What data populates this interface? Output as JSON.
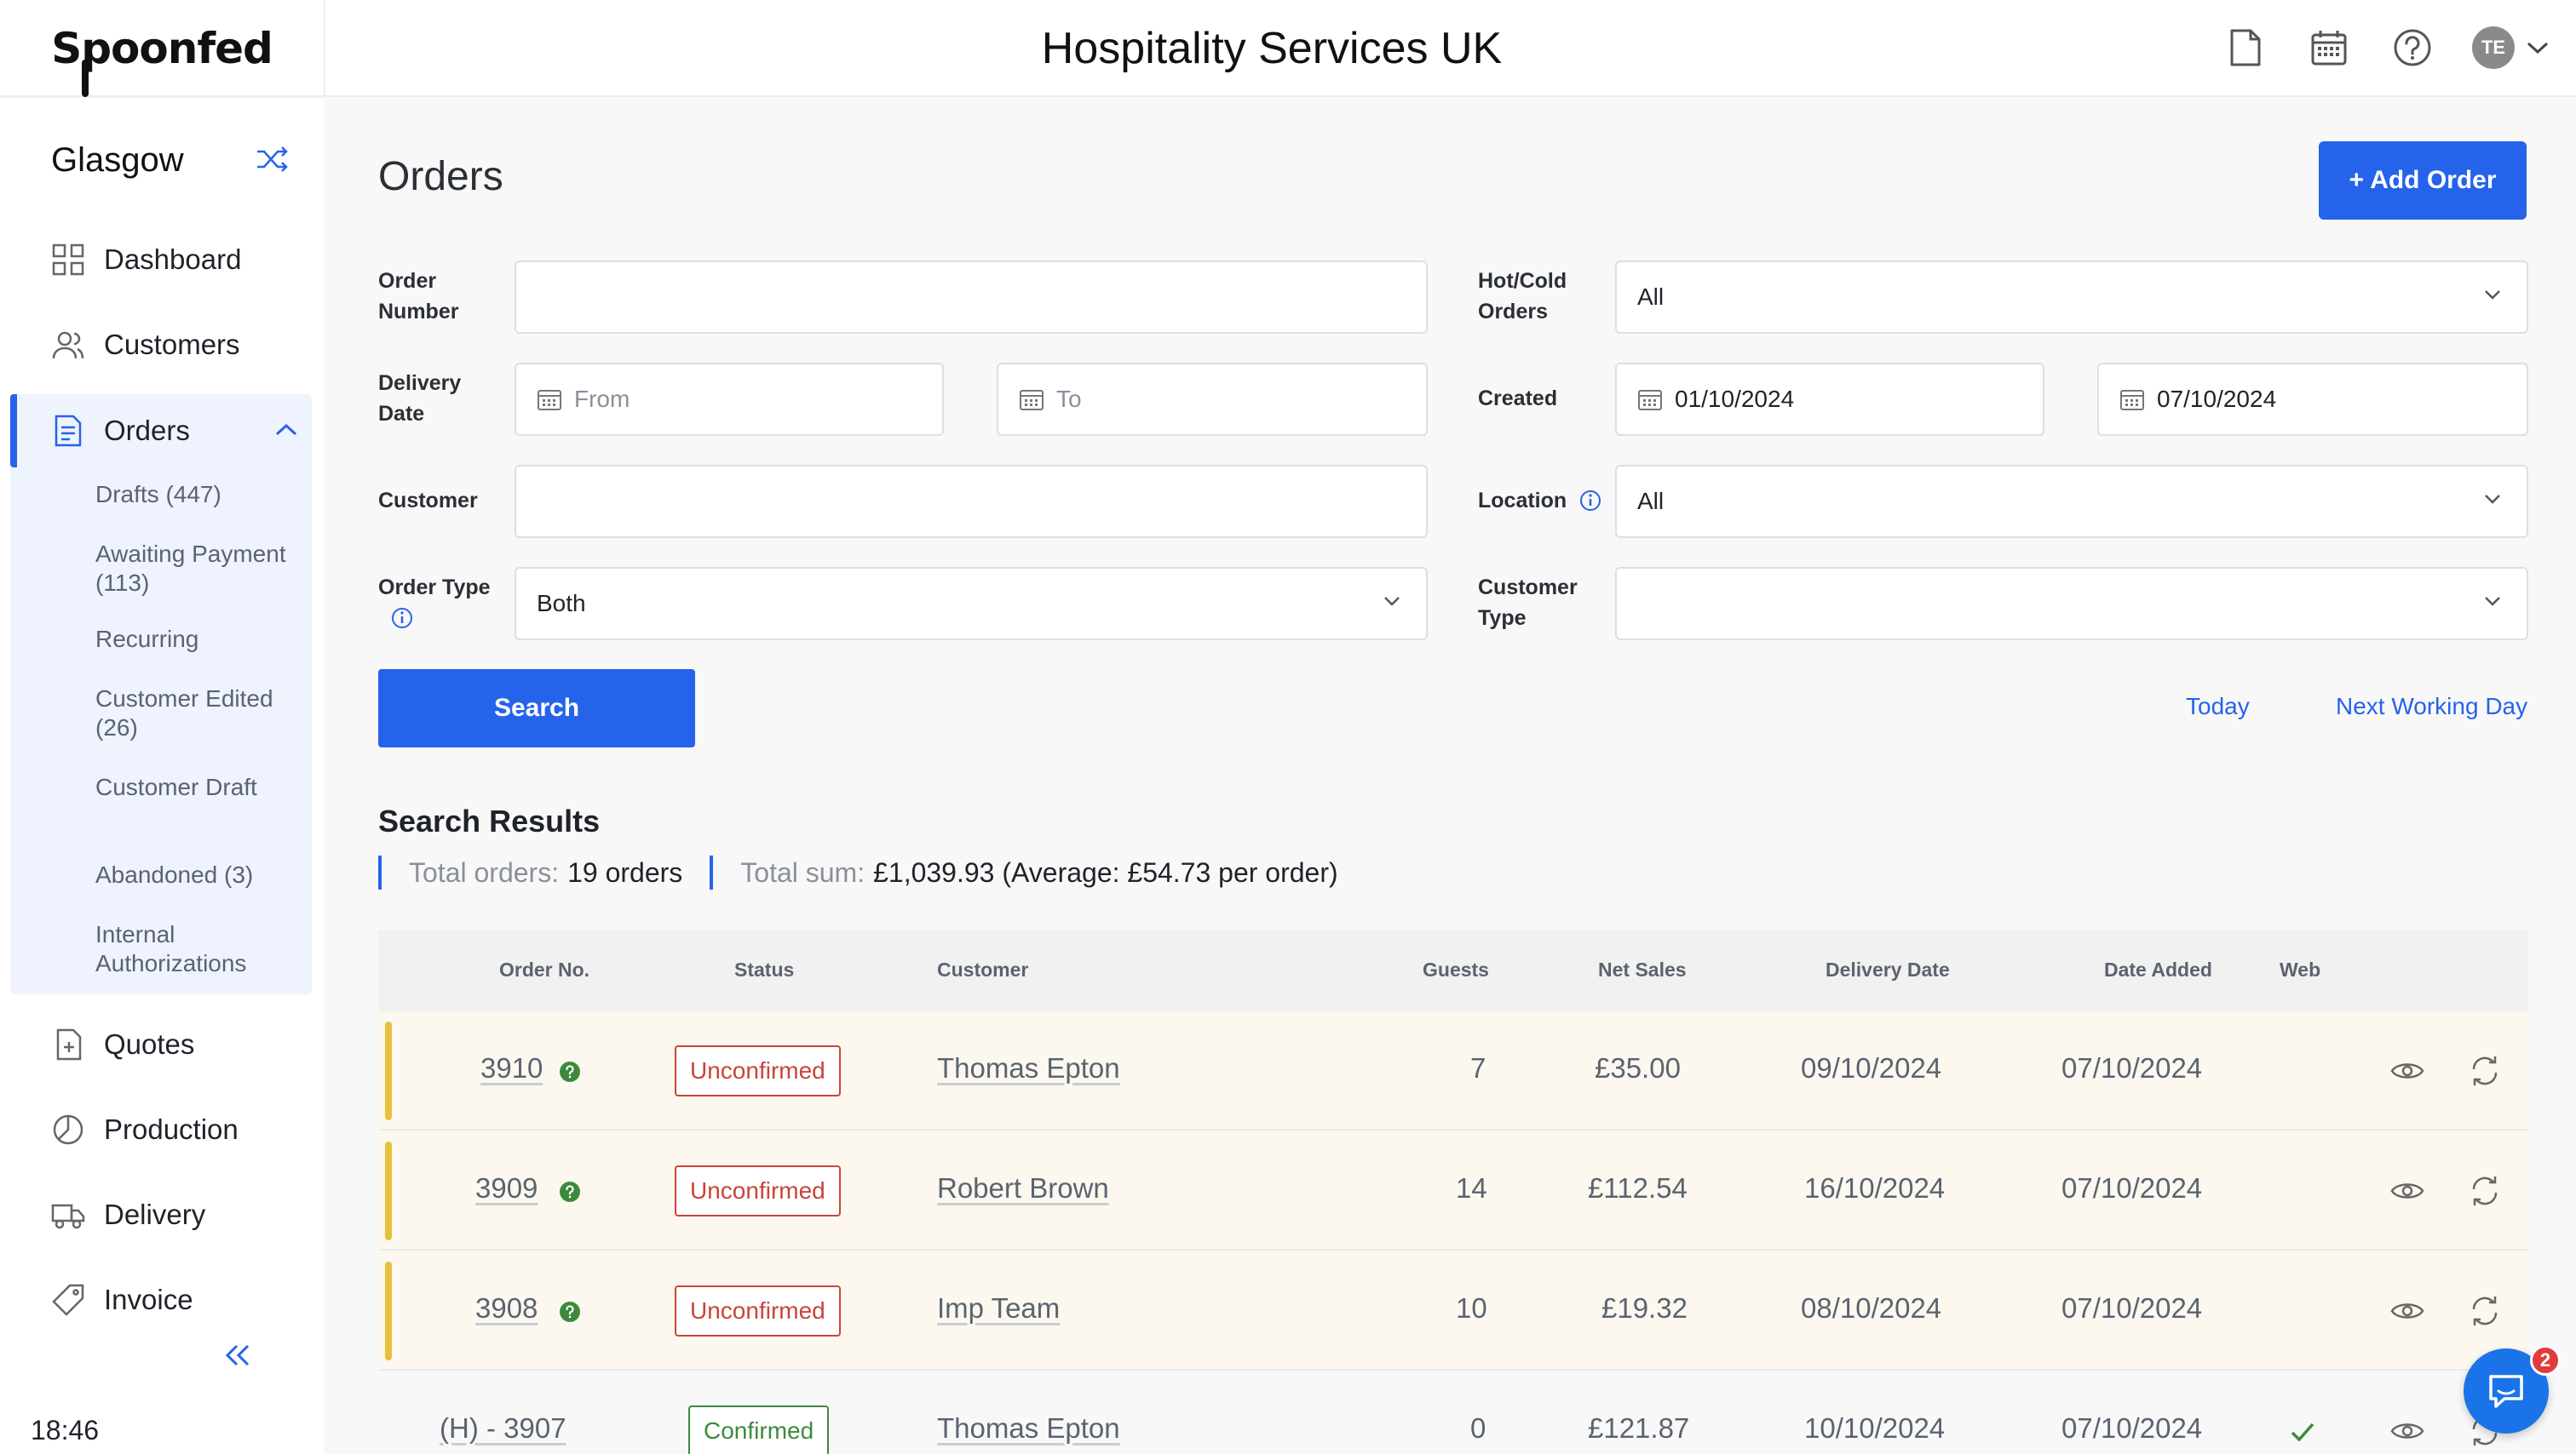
{
  "header": {
    "logo_text": "Spoonfed",
    "title": "Hospitality Services UK",
    "avatar_initials": "TE",
    "icons": [
      "document-icon",
      "calendar-icon",
      "help-icon",
      "chevron-down-icon"
    ]
  },
  "sidebar": {
    "location": "Glasgow",
    "items": [
      {
        "label": "Dashboard",
        "icon": "grid-icon"
      },
      {
        "label": "Customers",
        "icon": "users-icon"
      },
      {
        "label": "Orders",
        "icon": "document-icon",
        "active": true
      },
      {
        "label": "Quotes",
        "icon": "file-plus-icon"
      },
      {
        "label": "Production",
        "icon": "pie-icon"
      },
      {
        "label": "Delivery",
        "icon": "truck-icon"
      },
      {
        "label": "Invoice",
        "icon": "tag-icon"
      }
    ],
    "order_subitems": [
      "Drafts (447)",
      "Awaiting Payment (113)",
      "Recurring",
      "Customer Edited (26)",
      "Customer Draft",
      "Abandoned (3)",
      "Internal Authorizations"
    ],
    "clock": "18:46"
  },
  "main": {
    "title": "Orders",
    "add_order_label": "+ Add Order",
    "filters": {
      "order_number_label": "Order Number",
      "order_number_value": "",
      "hot_cold_label": "Hot/Cold Orders",
      "hot_cold_value": "All",
      "delivery_date_label": "Delivery Date",
      "delivery_from_placeholder": "From",
      "delivery_to_placeholder": "To",
      "created_label": "Created",
      "created_from": "01/10/2024",
      "created_to": "07/10/2024",
      "customer_label": "Customer",
      "customer_value": "",
      "location_label": "Location",
      "location_value": "All",
      "order_type_label": "Order Type",
      "order_type_value": "Both",
      "customer_type_label": "Customer Type",
      "customer_type_value": ""
    },
    "search_label": "Search",
    "today_label": "Today",
    "next_working_day_label": "Next Working Day",
    "results_title": "Search Results",
    "total_orders_label": "Total orders:",
    "total_orders_value": "19 orders",
    "total_sum_label": "Total sum:",
    "total_sum_value": "£1,039.93 (Average: £54.73 per order)",
    "columns": [
      "Order No.",
      "Status",
      "Customer",
      "Guests",
      "Net Sales",
      "Delivery Date",
      "Date Added",
      "Web"
    ],
    "rows": [
      {
        "order_no": "3910",
        "status": "Unconfirmed",
        "customer": "Thomas Epton",
        "guests": "7",
        "net_sales": "£35.00",
        "delivery_date": "09/10/2024",
        "date_added": "07/10/2024",
        "web": false
      },
      {
        "order_no": "3909",
        "status": "Unconfirmed",
        "customer": "Robert Brown",
        "guests": "14",
        "net_sales": "£112.54",
        "delivery_date": "16/10/2024",
        "date_added": "07/10/2024",
        "web": false
      },
      {
        "order_no": "3908",
        "status": "Unconfirmed",
        "customer": "Imp Team",
        "guests": "10",
        "net_sales": "£19.32",
        "delivery_date": "08/10/2024",
        "date_added": "07/10/2024",
        "web": false
      },
      {
        "order_no": "(H) - 3907",
        "status": "Confirmed",
        "customer": "Thomas Epton",
        "guests": "0",
        "net_sales": "£121.87",
        "delivery_date": "10/10/2024",
        "date_added": "07/10/2024",
        "web": true
      }
    ]
  },
  "chat": {
    "badge_count": "2"
  },
  "colors": {
    "accent": "#2563eb",
    "unconfirmed": "#c9443a",
    "confirmed": "#3d8a3e",
    "pending_row": "#fcf8ef",
    "pending_bar": "#e6c13b"
  }
}
